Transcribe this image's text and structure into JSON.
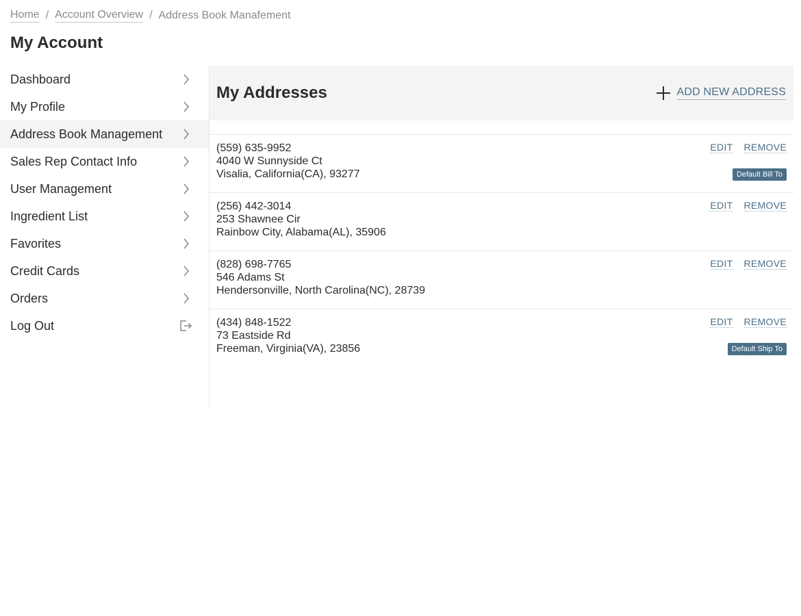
{
  "breadcrumb": {
    "home": "Home",
    "overview": "Account Overview",
    "current": "Address Book Manafement",
    "separator": "/"
  },
  "page_title": "My Account",
  "sidebar": {
    "items": [
      {
        "label": "Dashboard",
        "icon": "chevron-right-icon"
      },
      {
        "label": "My Profile",
        "icon": "chevron-right-icon"
      },
      {
        "label": "Address Book Management",
        "icon": "chevron-right-icon",
        "active": true
      },
      {
        "label": "Sales Rep Contact Info",
        "icon": "chevron-right-icon"
      },
      {
        "label": "User Management",
        "icon": "chevron-right-icon"
      },
      {
        "label": "Ingredient List",
        "icon": "chevron-right-icon"
      },
      {
        "label": "Favorites",
        "icon": "chevron-right-icon"
      },
      {
        "label": "Credit Cards",
        "icon": "chevron-right-icon"
      },
      {
        "label": "Orders",
        "icon": "chevron-right-icon"
      },
      {
        "label": "Log Out",
        "icon": "logout-icon"
      }
    ]
  },
  "main": {
    "title": "My Addresses",
    "add_label": "ADD NEW ADDRESS",
    "add_icon": "plus-icon",
    "edit_label": "EDIT",
    "remove_label": "REMOVE",
    "addresses": [
      {
        "phone": "(559) 635-9952",
        "street": "4040 W Sunnyside Ct",
        "city": "Visalia, California(CA), 93277",
        "badge": "Default Bill To"
      },
      {
        "phone": "(256) 442-3014",
        "street": "253 Shawnee Cir",
        "city": "Rainbow City, Alabama(AL), 35906",
        "badge": ""
      },
      {
        "phone": "(828) 698-7765",
        "street": "546 Adams St",
        "city": "Hendersonville, North Carolina(NC), 28739",
        "badge": ""
      },
      {
        "phone": "(434) 848-1522",
        "street": "73 Eastside Rd",
        "city": "Freeman, Virginia(VA), 23856",
        "badge": "Default Ship To"
      }
    ]
  },
  "colors": {
    "accent": "#4a6f87",
    "header_bg": "#f4f4f4",
    "text": "#2b2b2b",
    "muted": "#8a8a8a"
  }
}
